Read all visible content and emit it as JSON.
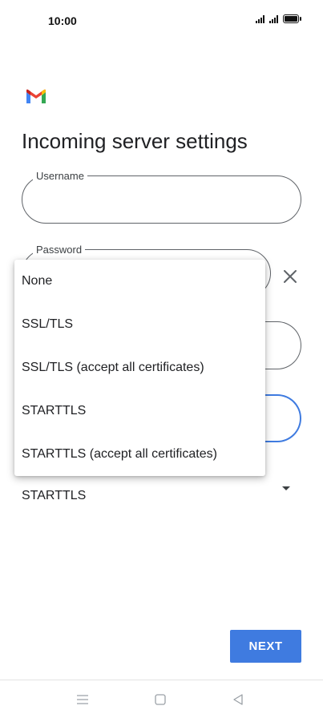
{
  "status_bar": {
    "time": "10:00"
  },
  "header": {
    "title": "Incoming server settings"
  },
  "form": {
    "username": {
      "label": "Username",
      "value": ""
    },
    "password": {
      "label": "Password",
      "value": ""
    },
    "security_type": {
      "value": "STARTTLS"
    }
  },
  "security_menu": {
    "options": [
      "None",
      "SSL/TLS",
      "SSL/TLS (accept all certificates)",
      "STARTTLS",
      "STARTTLS (accept all certificates)"
    ]
  },
  "actions": {
    "next_label": "NEXT"
  },
  "icons": {
    "logo": "gmail-logo-icon",
    "clear": "close-icon",
    "dropdown": "dropdown-arrow-icon",
    "nav": [
      "menu-icon",
      "home-icon",
      "back-icon"
    ]
  },
  "colors": {
    "accent": "#3f7be0",
    "text": "#202124"
  }
}
